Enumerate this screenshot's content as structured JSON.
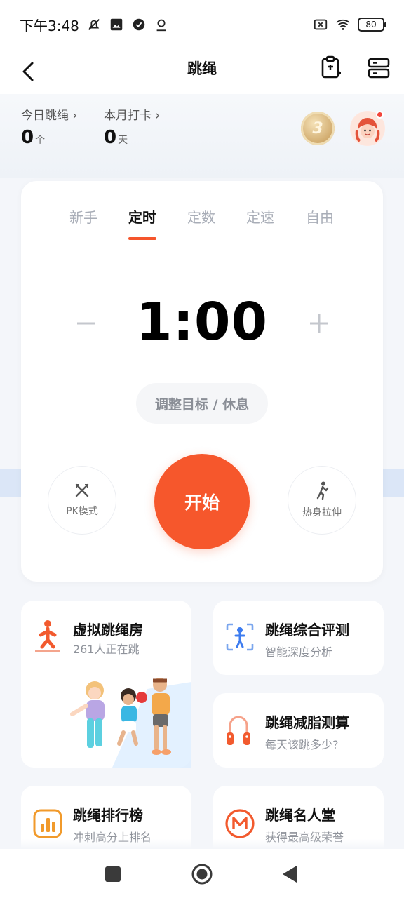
{
  "status_bar": {
    "time": "下午3:48",
    "battery": "80",
    "icons_left": [
      "mute-icon",
      "image-icon",
      "check-circle-icon",
      "location-icon"
    ],
    "icons_right": [
      "sim-off-icon",
      "wifi-icon",
      "battery-icon"
    ]
  },
  "header": {
    "title": "跳绳",
    "icons": [
      "back-icon",
      "clipboard-icon",
      "server-icon"
    ]
  },
  "stats": {
    "today_label": "今日跳绳 ›",
    "today_value": "0",
    "today_unit": "个",
    "month_label": "本月打卡 ›",
    "month_value": "0",
    "month_unit": "天"
  },
  "badge": {
    "medal_text": "3"
  },
  "mode_tabs": [
    "新手",
    "定时",
    "定数",
    "定速",
    "自由"
  ],
  "active_tab": "定时",
  "timer": {
    "value": "1:00",
    "minus": "−",
    "plus": "+",
    "adjust_label": "调整目标 / 休息"
  },
  "actions": {
    "pk_label": "PK模式",
    "start_label": "开始",
    "warmup_label": "热身拉伸"
  },
  "features": {
    "virtual_room": {
      "title": "虚拟跳绳房",
      "subtitle": "261人正在跳"
    },
    "assessment": {
      "title": "跳绳综合评测",
      "subtitle": "智能深度分析"
    },
    "fat_loss": {
      "title": "跳绳减脂测算",
      "subtitle": "每天该跳多少?"
    },
    "ranking": {
      "title": "跳绳排行榜",
      "subtitle": "冲刺高分上排名"
    },
    "hall_of_fame": {
      "title": "跳绳名人堂",
      "subtitle": "获得最高级荣誉"
    }
  },
  "bottom_nav": [
    "recent-apps-icon",
    "home-icon",
    "back-nav-icon"
  ],
  "colors": {
    "accent": "#f6572c",
    "tab_inactive": "#a8adb7",
    "assessment_blue": "#3d7cf0",
    "ranking_orange": "#f19a2b"
  }
}
